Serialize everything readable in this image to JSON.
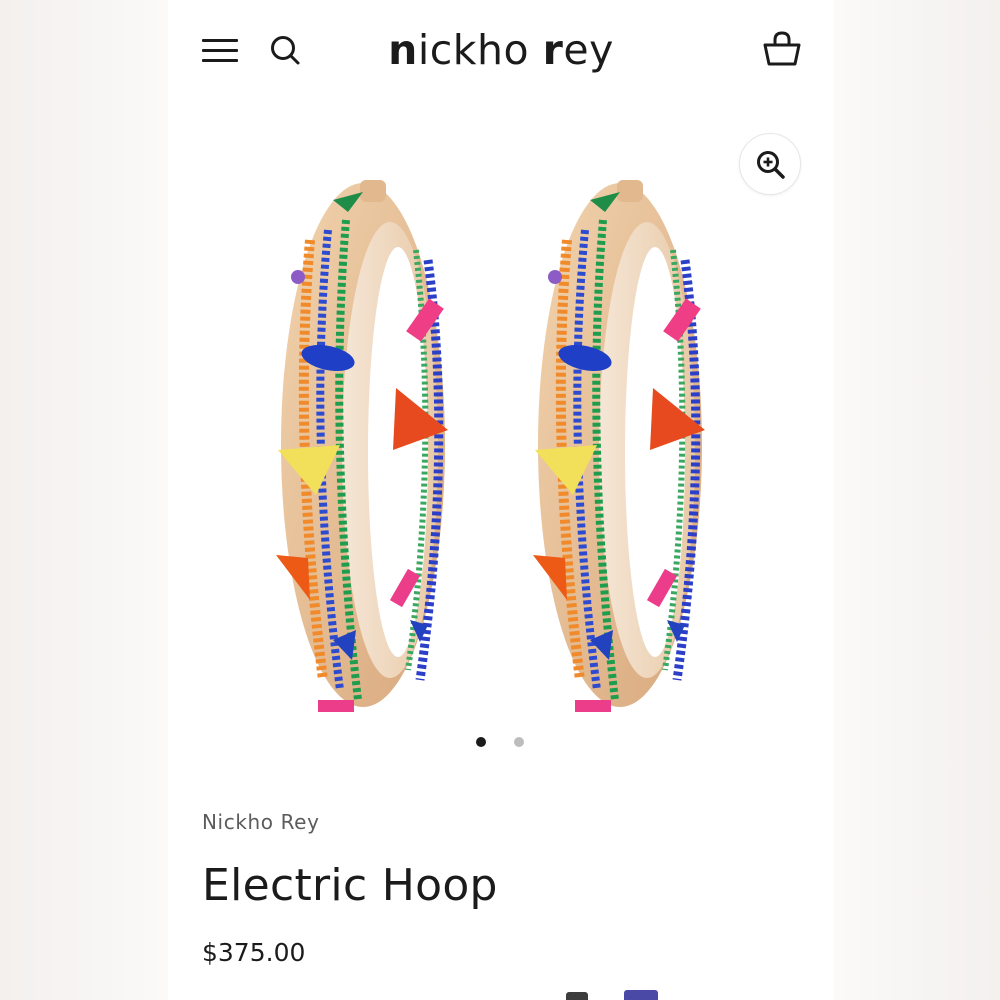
{
  "header": {
    "logo_part1_bold": "n",
    "logo_part1_rest": "ickho ",
    "logo_part2_bold": "r",
    "logo_part2_rest": "ey",
    "menu_icon": "hamburger-menu-icon",
    "search_icon": "search-icon",
    "cart_icon": "basket-icon"
  },
  "gallery": {
    "zoom_icon": "zoom-in-icon",
    "slide_count": 2,
    "active_slide": 1
  },
  "product": {
    "vendor": "Nickho Rey",
    "title": "Electric Hoop",
    "price": "$375.00"
  },
  "colors": {
    "text": "#1c1b1b",
    "dot_active": "#1c1b1b",
    "dot_inactive": "#bdbdbd",
    "gold": "#e0b98c"
  }
}
